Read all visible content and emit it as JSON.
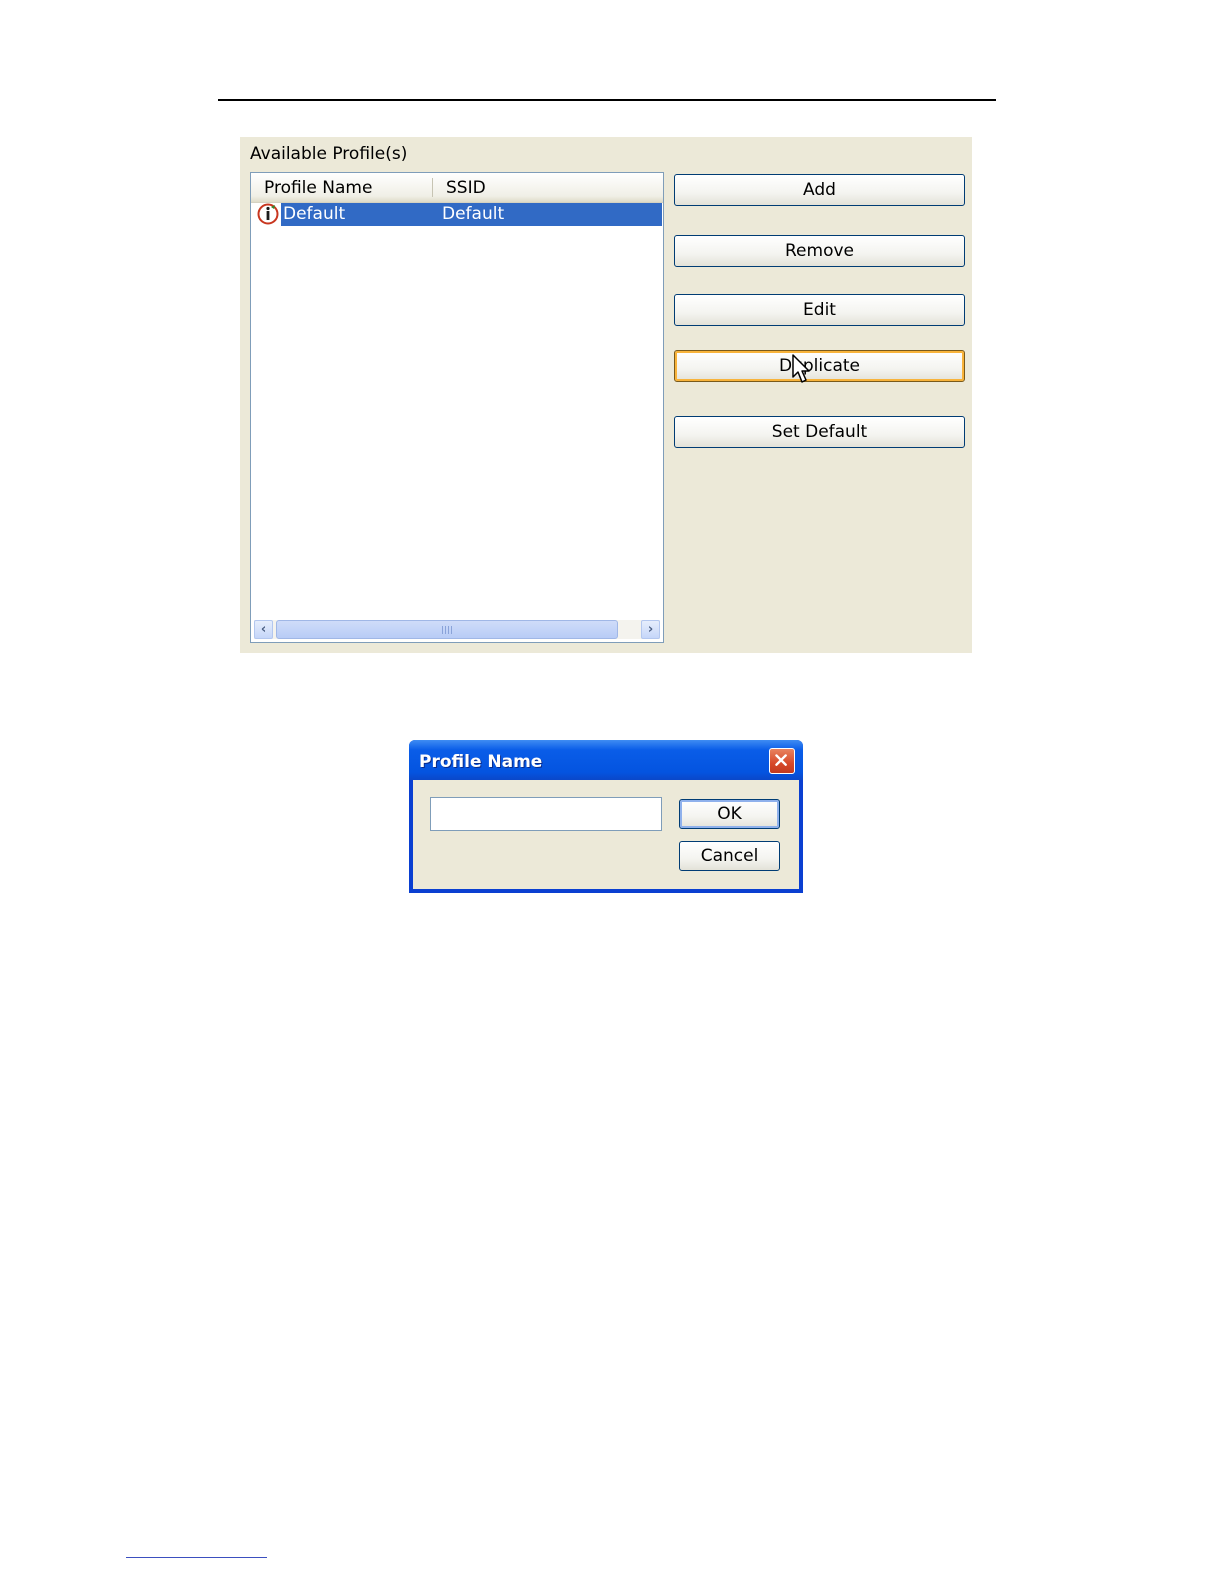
{
  "panel": {
    "title": "Available Profile(s)",
    "list": {
      "columns": [
        "Profile Name",
        "SSID"
      ],
      "rows": [
        {
          "profile_name": "Default",
          "ssid": "Default",
          "selected": true,
          "icon": "default-profile-icon"
        }
      ],
      "scroll_grip": "|||"
    },
    "buttons": {
      "add": "Add",
      "remove": "Remove",
      "edit": "Edit",
      "duplicate": "Duplicate",
      "set_default": "Set Default"
    }
  },
  "dialog": {
    "title": "Profile Name",
    "input_value": "",
    "ok": "OK",
    "cancel": "Cancel"
  },
  "colors": {
    "selection": "#316ac5",
    "panel_bg": "#ece9d8",
    "titlebar": "#0454e0",
    "focus_ring": "#f8b33a"
  }
}
